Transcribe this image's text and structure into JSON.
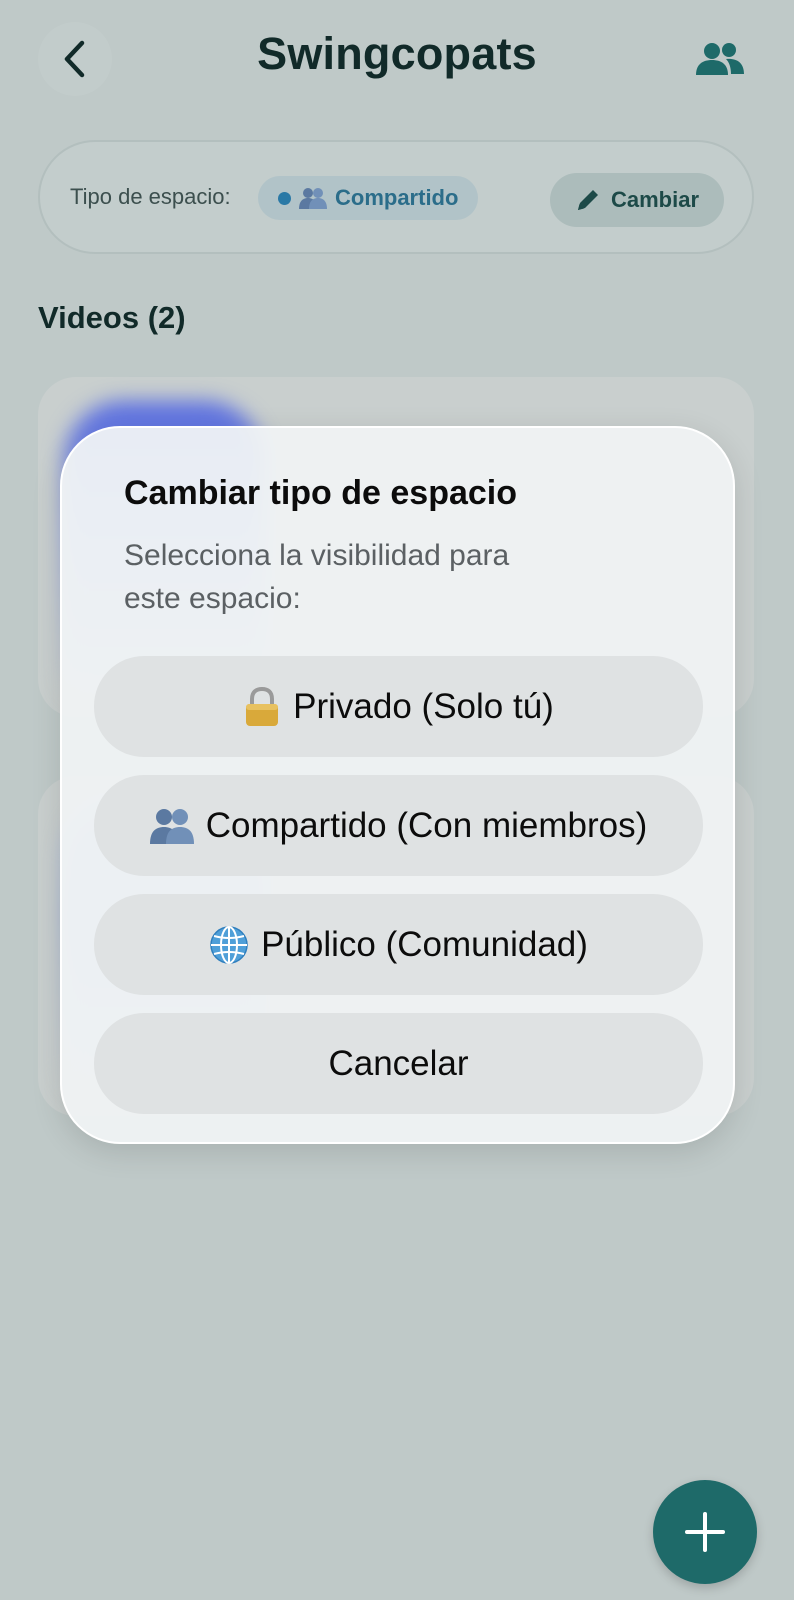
{
  "header": {
    "title": "Swingcopats",
    "back_icon": "chevron-left-icon",
    "members_icon": "people-icon"
  },
  "space": {
    "label": "Tipo de espacio:",
    "badge_label": "Compartido",
    "badge_icon": "people-emoji-icon",
    "change_label": "Cambiar",
    "change_icon": "pencil-icon"
  },
  "videos": {
    "heading": "Videos (2)",
    "count": 2
  },
  "modal": {
    "title": "Cambiar tipo de espacio",
    "subtitle": "Selecciona la visibilidad para este espacio:",
    "options": [
      {
        "label": "Privado (Solo tú)",
        "icon": "lock-icon"
      },
      {
        "label": "Compartido (Con miembros)",
        "icon": "people-emoji-icon"
      },
      {
        "label": "Público (Comunidad)",
        "icon": "globe-icon"
      }
    ],
    "cancel_label": "Cancelar"
  },
  "fab": {
    "icon": "plus-icon"
  },
  "colors": {
    "background": "#bfc9c8",
    "accent": "#1e6a69",
    "badge_text": "#2b6d8a",
    "modal_background": "#f0f3f4",
    "option_background": "#dfe2e3"
  }
}
